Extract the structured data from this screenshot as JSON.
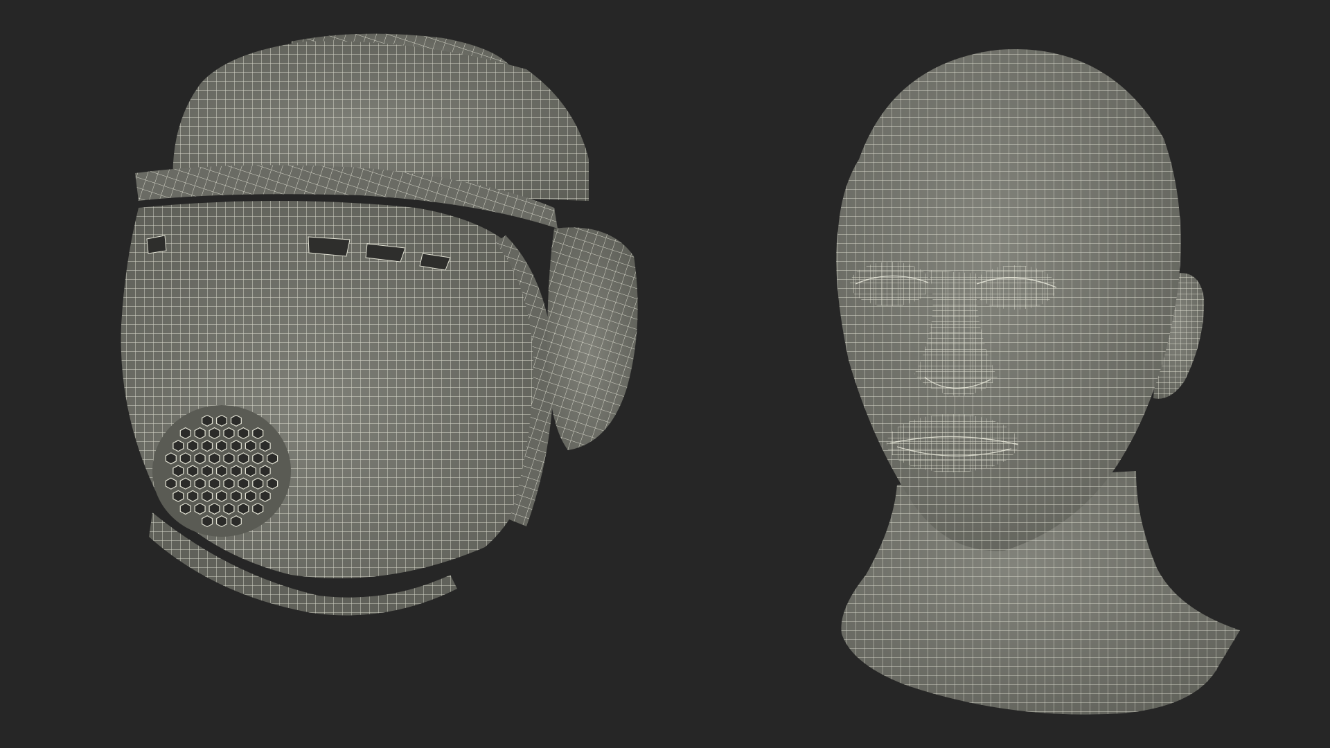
{
  "scene": {
    "background_color": "#262626",
    "surface_color": "#767770",
    "wire_color": "#e4e4d6",
    "shadow_color": "#55564f",
    "objects": [
      {
        "name": "wireframe-helmet",
        "kind": "wrestling headgear with ear guard and hexagonal vent grille"
      },
      {
        "name": "wireframe-head",
        "kind": "bald male head and neck mannequin"
      }
    ]
  }
}
